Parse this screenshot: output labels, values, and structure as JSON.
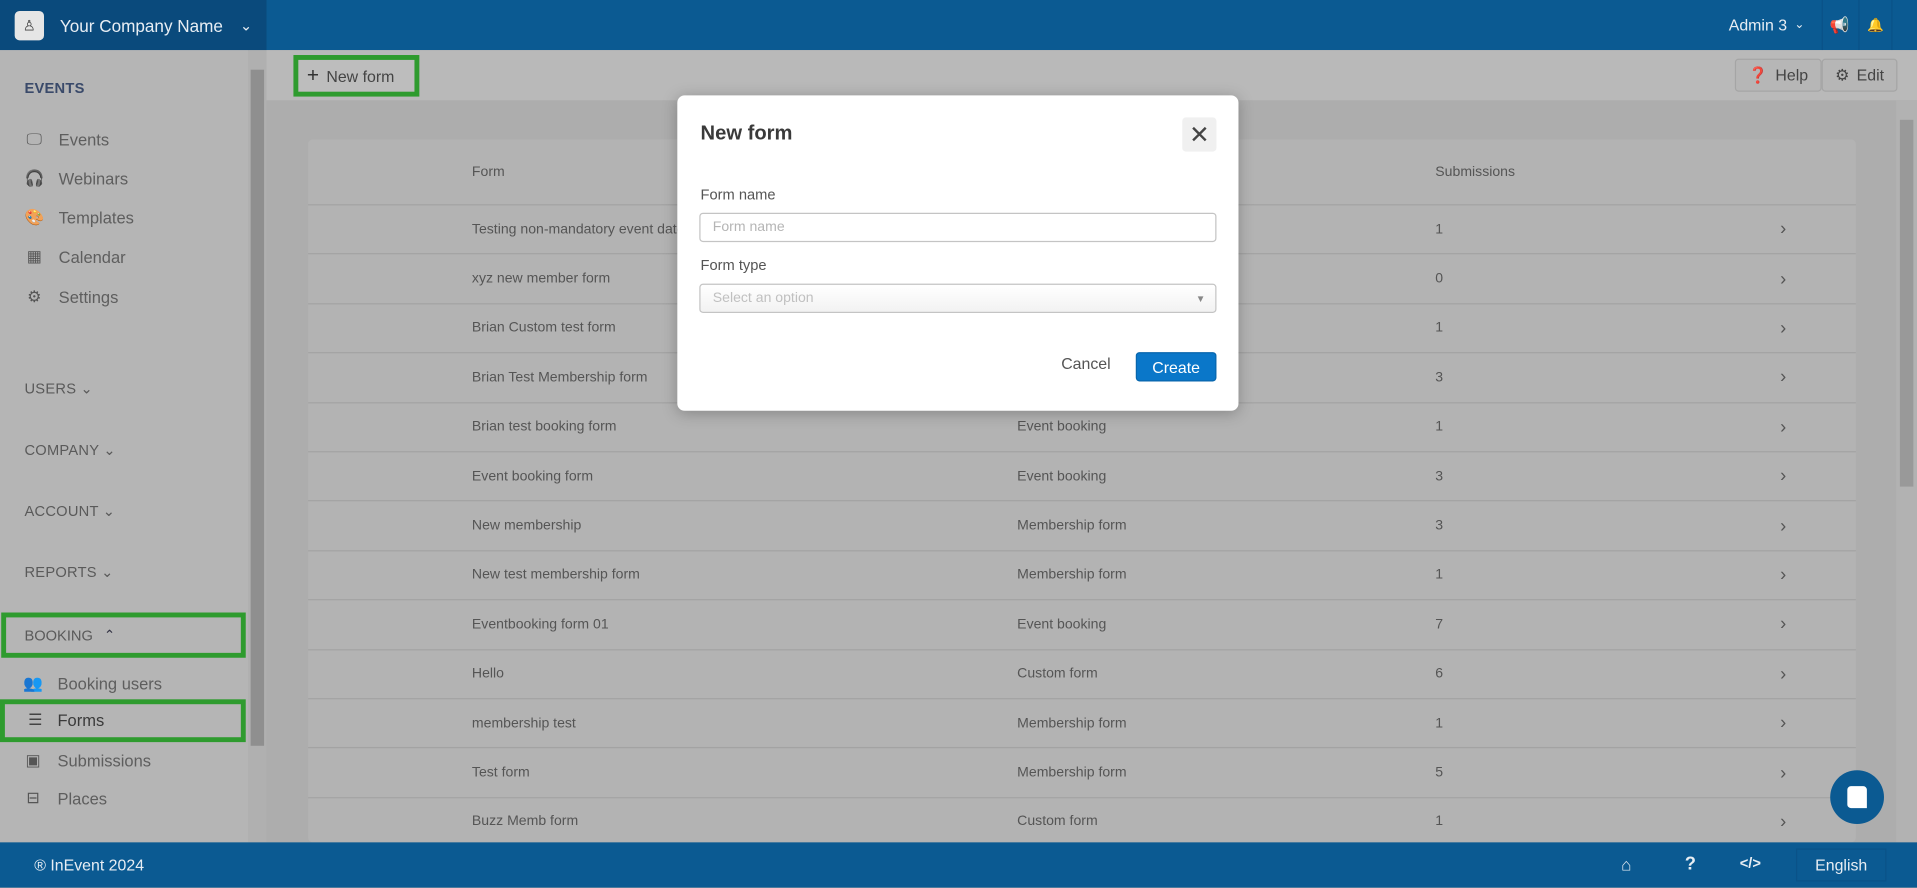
{
  "topbar": {
    "company": "Your Company Name",
    "user": "Admin 3",
    "icons": [
      "megaphone-icon",
      "bell-icon"
    ]
  },
  "sidebar": {
    "events_title": "EVENTS",
    "events_items": [
      {
        "label": "Events",
        "icon": "presentation-icon"
      },
      {
        "label": "Webinars",
        "icon": "headset-icon"
      },
      {
        "label": "Templates",
        "icon": "palette-icon"
      },
      {
        "label": "Calendar",
        "icon": "calendar-icon"
      },
      {
        "label": "Settings",
        "icon": "gear-icon"
      }
    ],
    "sections": [
      "USERS",
      "COMPANY",
      "ACCOUNT",
      "REPORTS"
    ],
    "booking": "BOOKING",
    "booking_items": [
      {
        "label": "Booking users",
        "icon": "users-icon"
      },
      {
        "label": "Forms",
        "icon": "list-icon"
      },
      {
        "label": "Submissions",
        "icon": "contact-book-icon"
      },
      {
        "label": "Places",
        "icon": "signpost-icon"
      }
    ]
  },
  "toolbar": {
    "new_form": "New form",
    "help": "Help",
    "edit": "Edit"
  },
  "table": {
    "headers": [
      "Form",
      "",
      "Submissions"
    ],
    "rows": [
      [
        "Testing non-mandatory event date",
        "",
        "1"
      ],
      [
        "xyz new member form",
        "",
        "0"
      ],
      [
        "Brian Custom test form",
        "",
        "1"
      ],
      [
        "Brian Test Membership form",
        "",
        "3"
      ],
      [
        "Brian test booking form",
        "Event booking",
        "1"
      ],
      [
        "Event booking form",
        "Event booking",
        "3"
      ],
      [
        "New membership",
        "Membership form",
        "3"
      ],
      [
        "New test membership form",
        "Membership form",
        "1"
      ],
      [
        "Eventbooking form 01",
        "Event booking",
        "7"
      ],
      [
        "Hello",
        "Custom form",
        "6"
      ],
      [
        "membership test",
        "Membership form",
        "1"
      ],
      [
        "Test form",
        "Membership form",
        "5"
      ],
      [
        "Buzz Memb form",
        "Custom form",
        "1"
      ]
    ]
  },
  "modal": {
    "title": "New form",
    "form_name_label": "Form name",
    "form_name_placeholder": "Form name",
    "form_name_value": "",
    "form_type_label": "Form type",
    "form_type_placeholder": "Select an option",
    "cancel": "Cancel",
    "create": "Create"
  },
  "footer": {
    "copyright": "® InEvent 2024",
    "language": "English"
  },
  "colors": {
    "brand": "#0b5a92",
    "accent": "#0a77c9",
    "highlight": "#2e9b2e"
  }
}
